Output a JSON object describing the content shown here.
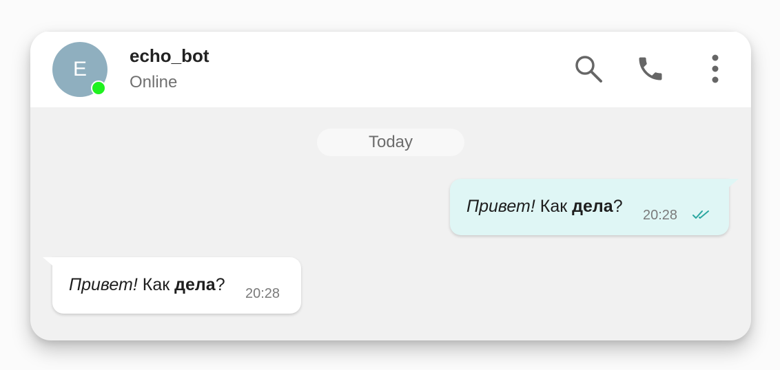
{
  "header": {
    "avatar_initial": "E",
    "contact_name": "echo_bot",
    "contact_status": "Online",
    "icons": [
      "search-icon",
      "phone-icon",
      "more-vertical-icon"
    ]
  },
  "chat": {
    "date_separator": "Today",
    "messages": [
      {
        "direction": "outgoing",
        "italic": "Привет!",
        "plain": " Как ",
        "bold": "дела",
        "tail": "?",
        "time": "20:28",
        "status_icon": "double-check-icon"
      },
      {
        "direction": "incoming",
        "italic": "Привет!",
        "plain": " Как ",
        "bold": "дела",
        "tail": "?",
        "time": "20:28"
      }
    ]
  },
  "colors": {
    "online_dot": "#1ff21f",
    "avatar_bg": "#8fafbf",
    "outgoing_bubble": "#dff6f5",
    "incoming_bubble": "#ffffff",
    "read_check": "#2aa7a0"
  }
}
